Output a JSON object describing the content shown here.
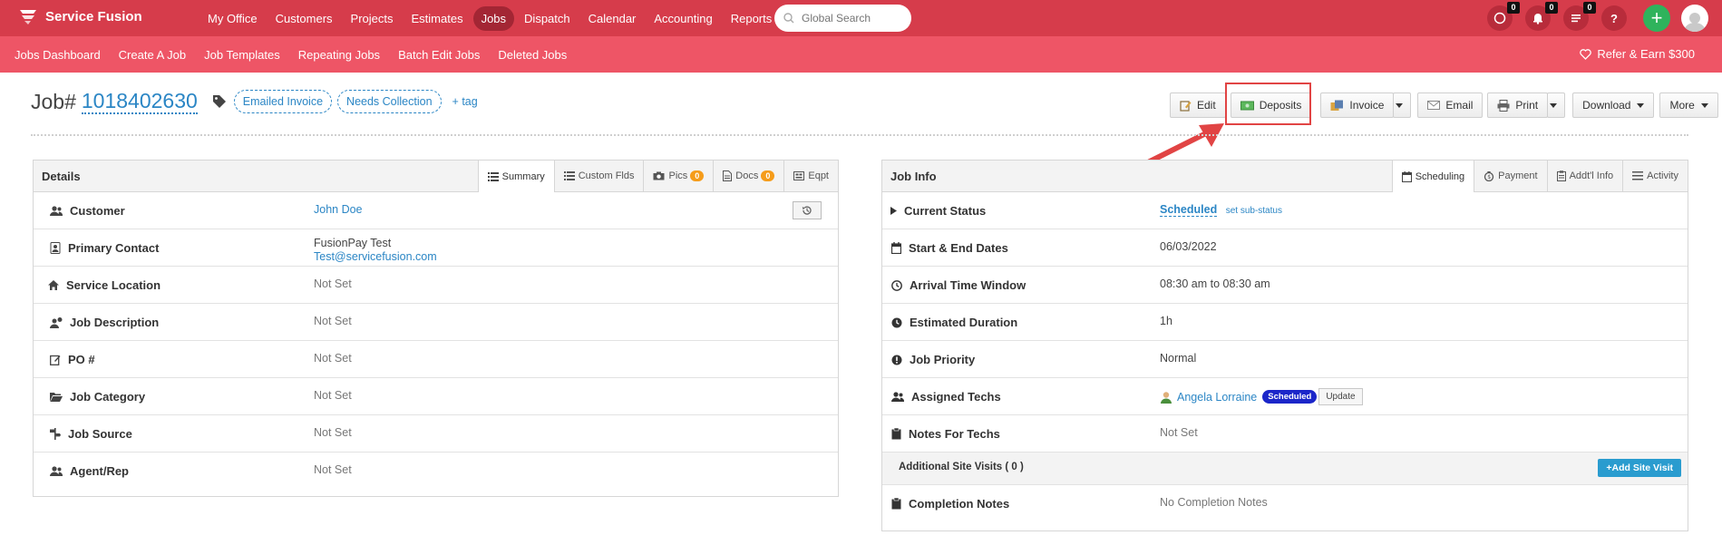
{
  "brand": {
    "name": "Service Fusion"
  },
  "topnav": [
    {
      "label": "My Office",
      "active": false
    },
    {
      "label": "Customers",
      "active": false
    },
    {
      "label": "Projects",
      "active": false
    },
    {
      "label": "Estimates",
      "active": false
    },
    {
      "label": "Jobs",
      "active": true
    },
    {
      "label": "Dispatch",
      "active": false
    },
    {
      "label": "Calendar",
      "active": false
    },
    {
      "label": "Accounting",
      "active": false
    },
    {
      "label": "Reports",
      "active": false
    }
  ],
  "search": {
    "placeholder": "Global Search"
  },
  "badges": {
    "chat": "0",
    "notifications": "0",
    "tasks": "0"
  },
  "subnav": [
    "Jobs Dashboard",
    "Create A Job",
    "Job Templates",
    "Repeating Jobs",
    "Batch Edit Jobs",
    "Deleted Jobs"
  ],
  "refer": "Refer & Earn $300",
  "job": {
    "label": "Job#",
    "number": "1018402630",
    "tags": [
      "Emailed Invoice",
      "Needs Collection"
    ],
    "add_tag": "+ tag"
  },
  "actions": {
    "edit": "Edit",
    "deposits": "Deposits",
    "invoice": "Invoice",
    "email": "Email",
    "print": "Print",
    "download": "Download",
    "more": "More"
  },
  "details": {
    "title": "Details",
    "tabs": {
      "summary": "Summary",
      "custom": "Custom Flds",
      "pics": "Pics",
      "pics_count": "0",
      "docs": "Docs",
      "docs_count": "0",
      "eqpt": "Eqpt"
    },
    "rows": {
      "customer": {
        "label": "Customer",
        "value": "John Doe"
      },
      "primary_contact": {
        "label": "Primary Contact",
        "name": "FusionPay Test",
        "email": "Test@servicefusion.com"
      },
      "service_location": {
        "label": "Service Location",
        "value": "Not Set"
      },
      "job_description": {
        "label": "Job Description",
        "value": "Not Set"
      },
      "po": {
        "label": "PO #",
        "value": "Not Set"
      },
      "job_category": {
        "label": "Job Category",
        "value": "Not Set"
      },
      "job_source": {
        "label": "Job Source",
        "value": "Not Set"
      },
      "agent_rep": {
        "label": "Agent/Rep",
        "value": "Not Set"
      }
    }
  },
  "jobinfo": {
    "title": "Job Info",
    "tabs": {
      "scheduling": "Scheduling",
      "payment": "Payment",
      "addtl": "Addt'l Info",
      "activity": "Activity"
    },
    "rows": {
      "status": {
        "label": "Current Status",
        "value": "Scheduled",
        "sub": "set sub-status"
      },
      "dates": {
        "label": "Start & End Dates",
        "value": "06/03/2022"
      },
      "arrival": {
        "label": "Arrival Time Window",
        "value": "08:30 am to 08:30 am"
      },
      "duration": {
        "label": "Estimated Duration",
        "value": "1h"
      },
      "priority": {
        "label": "Job Priority",
        "value": "Normal"
      },
      "techs": {
        "label": "Assigned Techs",
        "name": "Angela Lorraine",
        "badge": "Scheduled",
        "update": "Update"
      },
      "notes": {
        "label": "Notes For Techs",
        "value": "Not Set"
      },
      "visits": {
        "label": "Additional Site Visits ( 0 )",
        "button": "Add Site Visit"
      },
      "completion": {
        "label": "Completion Notes",
        "value": "No Completion Notes"
      }
    }
  },
  "colors": {
    "topbar": "#d63c4b",
    "subbar": "#ee5566",
    "link": "#2b86c5",
    "highlight": "#e14444",
    "plus": "#2fb35c",
    "badge_orange": "#f59c1a",
    "scheduled_badge": "#1b26c9"
  }
}
